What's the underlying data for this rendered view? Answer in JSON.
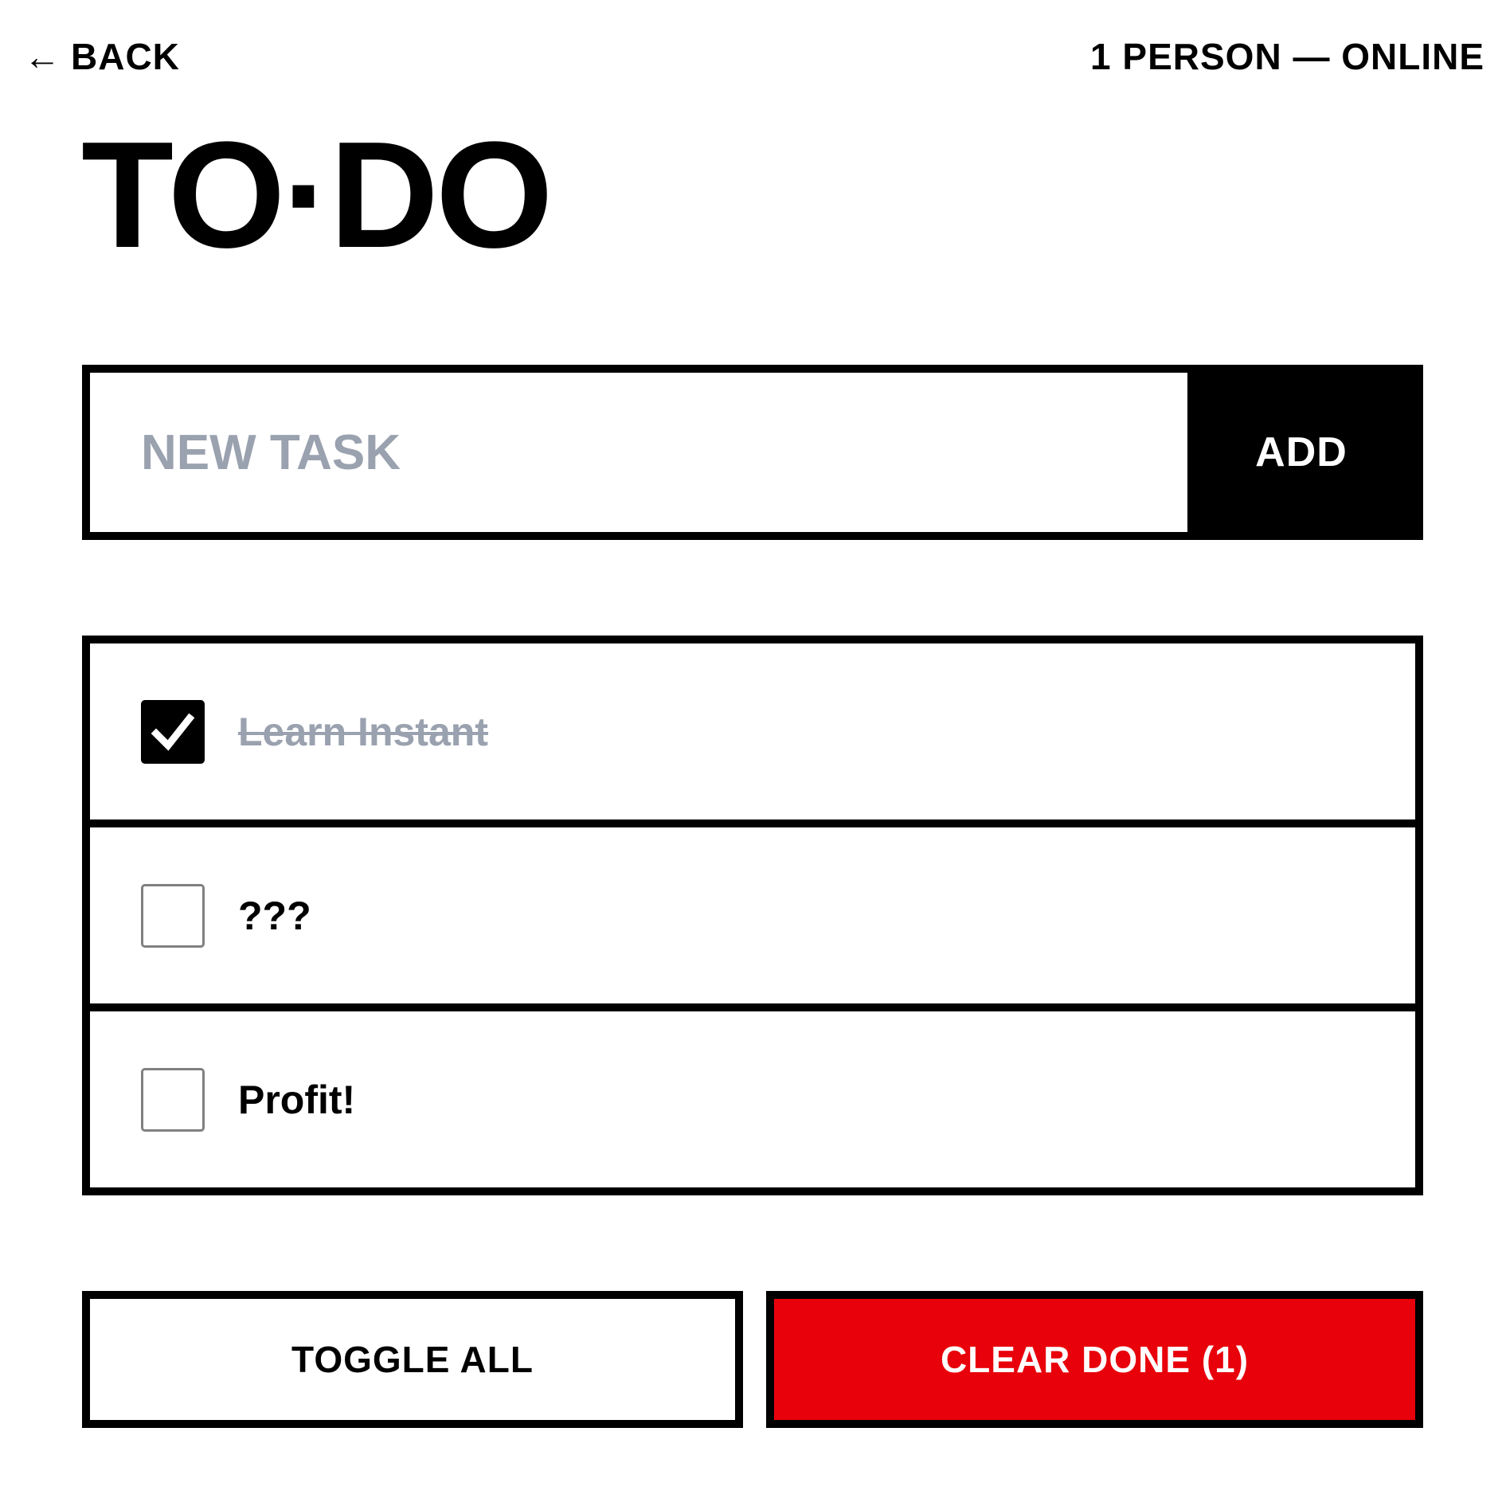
{
  "header": {
    "back_arrow": "←",
    "back_label": "BACK",
    "presence": "1 PERSON — ONLINE"
  },
  "title": "TO·DO",
  "new_task": {
    "placeholder": "NEW TASK",
    "value": "",
    "add_label": "ADD"
  },
  "todos": [
    {
      "text": "Learn Instant",
      "done": true
    },
    {
      "text": "???",
      "done": false
    },
    {
      "text": "Profit!",
      "done": false
    }
  ],
  "actions": {
    "toggle_all_label": "TOGGLE ALL",
    "clear_done_label": "CLEAR DONE (1)"
  },
  "colors": {
    "accent": "#e8000b",
    "placeholder": "#9aa1af",
    "border": "#000000",
    "background": "#ffffff"
  }
}
